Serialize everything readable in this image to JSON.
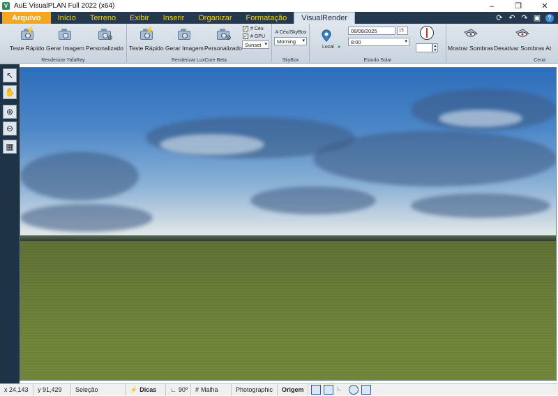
{
  "window": {
    "title": "AuE VisualPLAN Full 2022 (x64)",
    "app_icon": "app-logo-icon",
    "controls": [
      "minimize-icon",
      "restore-icon",
      "close-icon"
    ]
  },
  "menu": {
    "items": [
      "Arquivo",
      "Início",
      "Terreno",
      "Exibir",
      "Inserir",
      "Organizar",
      "Formatação",
      "VisualRender"
    ],
    "active": "VisualRender",
    "file_color": "#f5a623",
    "item_color": "#f5d800",
    "bar_color": "#24394e"
  },
  "quick_access": [
    "refresh-icon",
    "undo-icon",
    "redo-icon",
    "save-icon",
    "help-icon"
  ],
  "help_glyph": "?",
  "ribbon": {
    "yafaray": {
      "label": "Renderizar YafaRay",
      "buttons": [
        "Teste Rápido",
        "Gerar Imagem",
        "Personalizado"
      ]
    },
    "luxcore": {
      "label": "Renderizar LuxCore Beta",
      "buttons": [
        "Teste Rápido",
        "Gerar Imagem",
        "Personalizado"
      ],
      "check_sky": "# Céu",
      "check_gpu": "# GPU",
      "preset": "Sunset"
    },
    "skybox": {
      "label": "SkyBox",
      "title": "# Céu/SkyBox",
      "option": "Morning"
    },
    "solar": {
      "label": "Estudo Solar",
      "local": "Local",
      "date": "08/08/2025",
      "calendar_day": "15",
      "time": "8:00"
    },
    "cena": {
      "label": "Cena",
      "show_shadows": "Mostrar Sombras",
      "hide_shadows": "Desativar Sombras At"
    }
  },
  "left_tools": [
    "select-arrow-icon",
    "pan-hand-icon",
    "zoom-in-icon",
    "zoom-out-icon",
    "zoom-window-icon"
  ],
  "status": {
    "x": "x 24,143",
    "y": "y 91,429",
    "selection": "Seleção",
    "tips": "Dicas",
    "angle": "90º",
    "grid": "Malha",
    "mode": "Photographic",
    "origin": "Origem"
  }
}
